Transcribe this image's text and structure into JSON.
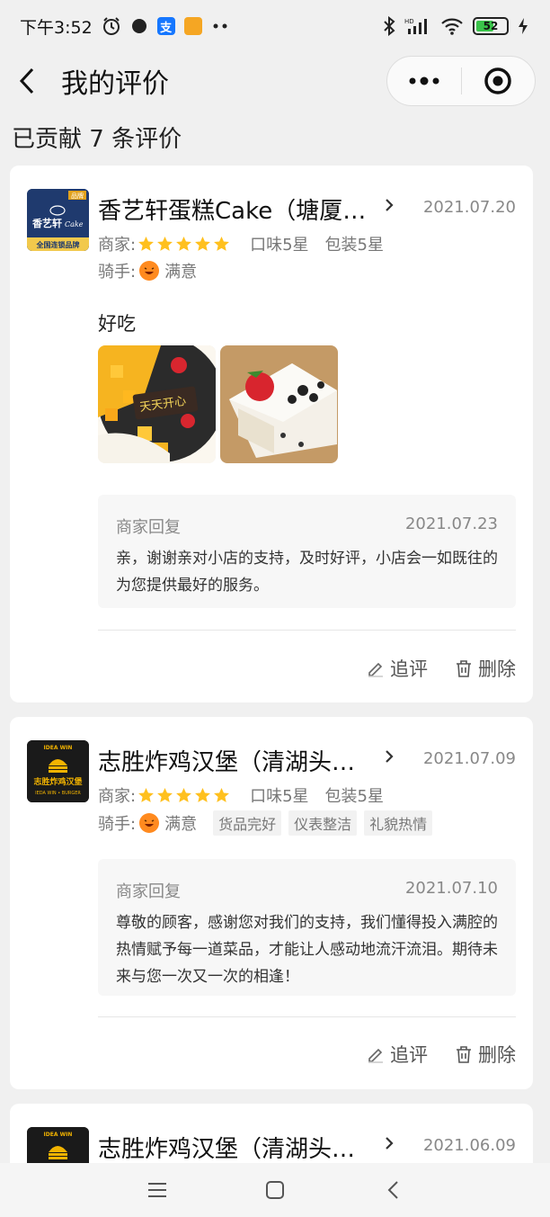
{
  "status_bar": {
    "time": "下午3:52",
    "battery": "52",
    "network": "HD"
  },
  "nav": {
    "title": "我的评价",
    "back": "back",
    "more": "more",
    "target": "target"
  },
  "summary": "已贡献 7 条评价",
  "labels": {
    "merchant": "商家:",
    "rider": "骑手:",
    "taste": "口味5星",
    "package": "包装5星",
    "satisfied": "满意",
    "reply_title": "商家回复",
    "follow_up": "追评",
    "delete": "删除"
  },
  "reviews": [
    {
      "shop": "香艺轩蛋糕Cake（塘厦…",
      "date": "2021.07.20",
      "stars": 5,
      "text": "好吃",
      "tags": [],
      "photo_labels": [
        "天天开心"
      ],
      "reply_date": "2021.07.23",
      "reply_text": "亲，谢谢亲对小店的支持，及时好评，小店会一如既往的为您提供最好的服务。",
      "logo": {
        "top": "品牌",
        "name": "香艺轩",
        "name_suffix": "Cake",
        "bottom": "全国连锁品牌",
        "color": "#1f3a6e"
      }
    },
    {
      "shop": "志胜炸鸡汉堡（清湖头…",
      "date": "2021.07.09",
      "stars": 5,
      "text": "",
      "tags": [
        "货品完好",
        "仪表整洁",
        "礼貌热情"
      ],
      "reply_date": "2021.07.10",
      "reply_text": "尊敬的顾客，感谢您对我们的支持，我们懂得投入满腔的热情赋予每一道菜品，才能让人感动地流汗流泪。期待未来与您一次又一次的相逢！",
      "logo": {
        "top": "IDEA WIN",
        "name": "志胜炸鸡汉堡",
        "bottom": "IEDA WIN • BURGER",
        "color": "#1a1a1a"
      }
    },
    {
      "shop": "志胜炸鸡汉堡（清湖头…",
      "date": "2021.06.09",
      "logo": {
        "top": "IDEA WIN",
        "color": "#1a1a1a"
      }
    }
  ]
}
